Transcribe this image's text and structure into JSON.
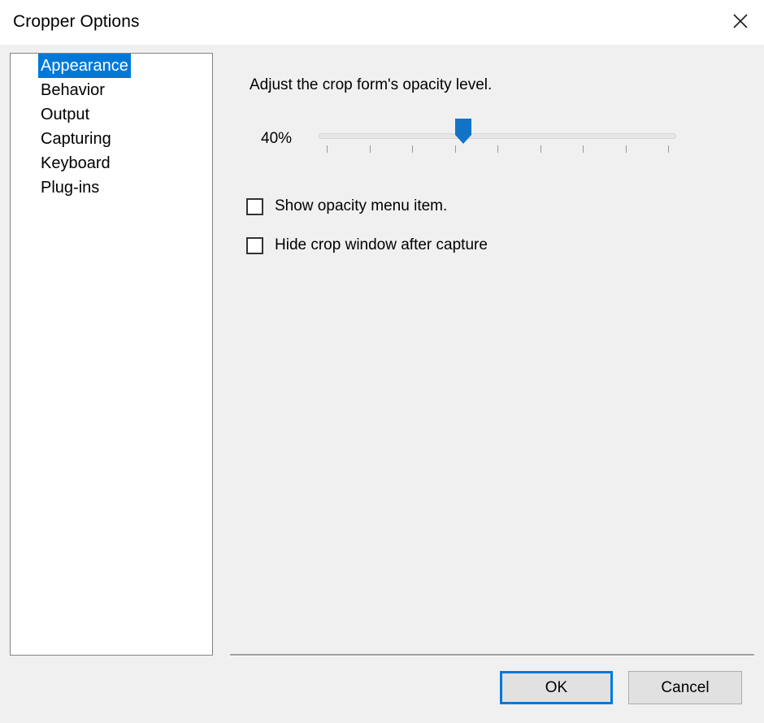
{
  "window": {
    "title": "Cropper Options",
    "close_icon": "close-icon"
  },
  "categories": {
    "items": [
      {
        "label": "Appearance",
        "selected": true
      },
      {
        "label": "Behavior",
        "selected": false
      },
      {
        "label": "Output",
        "selected": false
      },
      {
        "label": "Capturing",
        "selected": false
      },
      {
        "label": "Keyboard",
        "selected": false
      },
      {
        "label": "Plug-ins",
        "selected": false
      }
    ]
  },
  "appearance": {
    "instruction": "Adjust the crop form's opacity level.",
    "opacity": {
      "value_label": "40%",
      "value": 40,
      "min": 0,
      "max": 100,
      "tick_count": 9,
      "thumb_color": "#1274c8",
      "track_color": "#e6e6e6"
    },
    "checkboxes": [
      {
        "label": "Show opacity menu item.",
        "checked": false
      },
      {
        "label": "Hide crop window after capture",
        "checked": false
      }
    ]
  },
  "footer": {
    "ok_label": "OK",
    "cancel_label": "Cancel",
    "focus_color": "#0078d7"
  }
}
